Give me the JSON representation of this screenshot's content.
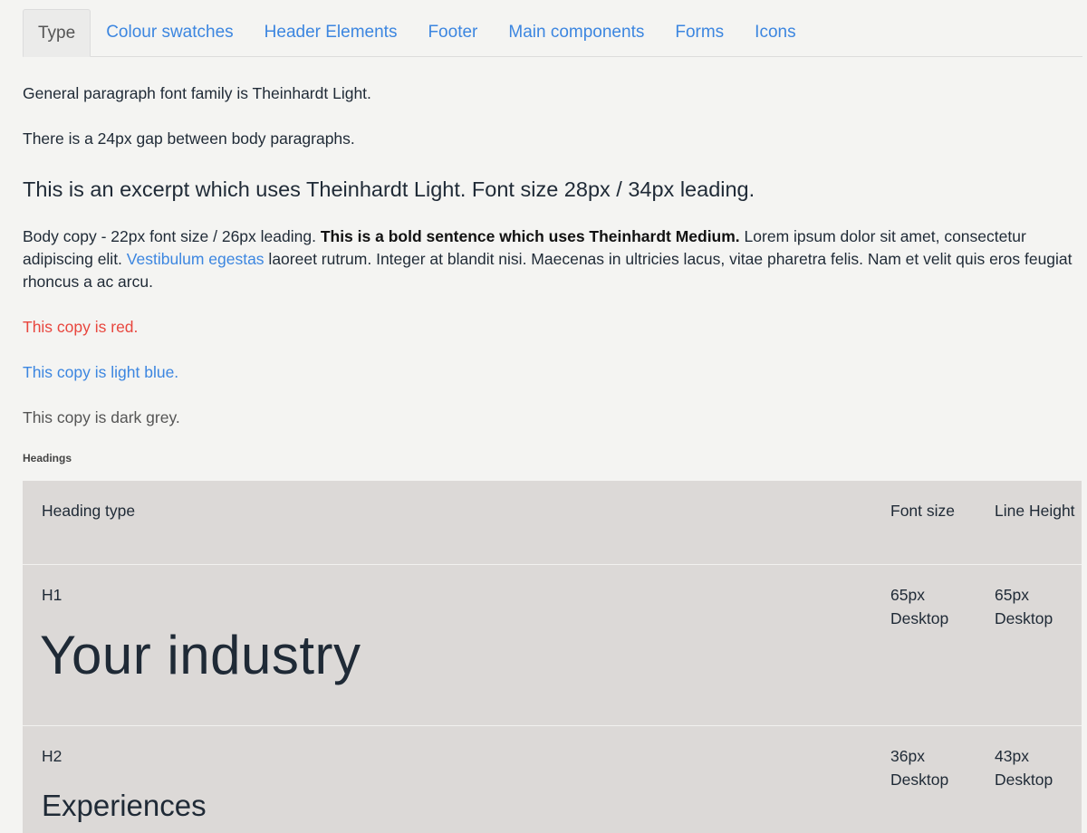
{
  "tabs": [
    {
      "label": "Type",
      "active": true
    },
    {
      "label": "Colour swatches",
      "active": false
    },
    {
      "label": "Header Elements",
      "active": false
    },
    {
      "label": "Footer",
      "active": false
    },
    {
      "label": "Main components",
      "active": false
    },
    {
      "label": "Forms",
      "active": false
    },
    {
      "label": "Icons",
      "active": false
    }
  ],
  "type": {
    "p1": "General paragraph font family is Theinhardt Light.",
    "p2": "There is a 24px gap between body paragraphs.",
    "excerpt": "This is an excerpt which uses Theinhardt Light. Font size 28px / 34px leading.",
    "body_copy": {
      "lead": "Body copy - 22px font size / 26px leading. ",
      "bold": "This is a bold sentence which uses Theinhardt Medium.",
      "mid": " Lorem ipsum dolor sit amet, consectetur adipiscing elit. ",
      "link": "Vestibulum egestas",
      "tail": " laoreet rutrum. Integer at blandit nisi. Maecenas in ultricies lacus, vitae pharetra felis. Nam et velit quis eros feugiat rhoncus a ac arcu."
    },
    "red": "This copy is red.",
    "lightblue": "This copy is light blue.",
    "darkgrey": "This copy is dark grey.",
    "headings_label": "Headings"
  },
  "headings_table": {
    "columns": [
      "Heading type",
      "Font size",
      "Line Height"
    ],
    "rows": [
      {
        "type": "H1",
        "sample": "Your industry",
        "font_size": "65px Desktop",
        "line_height": "65px Desktop"
      },
      {
        "type": "H2",
        "sample": "Experiences",
        "font_size": "36px Desktop",
        "line_height": "43px Desktop"
      }
    ]
  },
  "colors": {
    "link_blue": "#3c86e0",
    "red": "#e8463e",
    "dark_grey": "#555555",
    "table_bg": "#dcd9d7",
    "page_bg": "#f4f4f2"
  }
}
